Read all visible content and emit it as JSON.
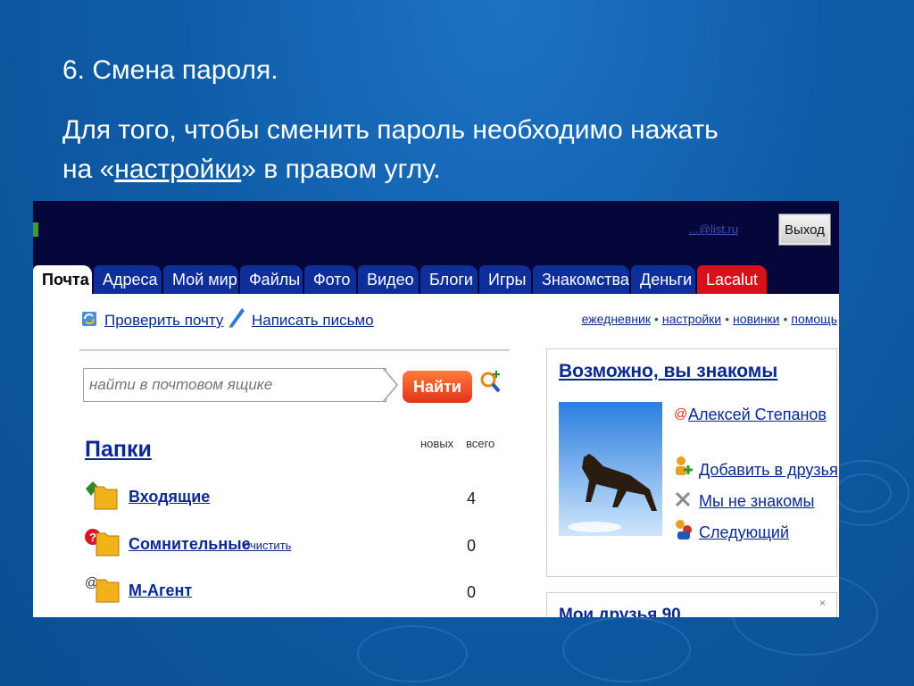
{
  "slide": {
    "title": "6. Смена пароля.",
    "text_part1": "Для того, чтобы сменить пароль необходимо нажать на «",
    "text_link": "настройки",
    "text_part2": "» в правом углу."
  },
  "mail": {
    "header": {
      "account_label": "...@list.ru",
      "exit_button": "Выход"
    },
    "tabs": [
      {
        "label": "Почта",
        "state": "active"
      },
      {
        "label": "Адреса"
      },
      {
        "label": "Мой мир"
      },
      {
        "label": "Файлы"
      },
      {
        "label": "Фото"
      },
      {
        "label": "Видео"
      },
      {
        "label": "Блоги"
      },
      {
        "label": "Игры"
      },
      {
        "label": "Знакомства"
      },
      {
        "label": "Деньги"
      },
      {
        "label": "Lacalut",
        "color": "#d8101c"
      }
    ],
    "toolbar": {
      "check_mail": "Проверить почту",
      "write_mail": "Написать письмо"
    },
    "top_links": [
      "ежедневник",
      "настройки",
      "новинки",
      "помощь"
    ],
    "search": {
      "placeholder": "найти в почтовом ящике",
      "button": "Найти"
    },
    "folders": {
      "title": "Папки",
      "col_new": "новых",
      "col_total": "всего",
      "items": [
        {
          "name": "Входящие",
          "total": "4"
        },
        {
          "name": "Сомнительные",
          "action": "очистить",
          "total": "0"
        },
        {
          "name": "М-Агент",
          "total": "0"
        }
      ]
    },
    "suggest": {
      "title": "Возможно, вы знакомы",
      "person": "Алексей Степанов",
      "add_friend": "Добавить в друзья",
      "not_known": "Мы не знакомы",
      "next": "Следующий"
    },
    "panel2_title": "Мои друзья 90"
  },
  "colors": {
    "slide_bg": "#0f5da8",
    "mail_header": "#05063a",
    "tab_blue": "#0e2f9a",
    "tab_red": "#d8101c",
    "link": "#0b2a8f",
    "find_button": "#e2341b"
  }
}
